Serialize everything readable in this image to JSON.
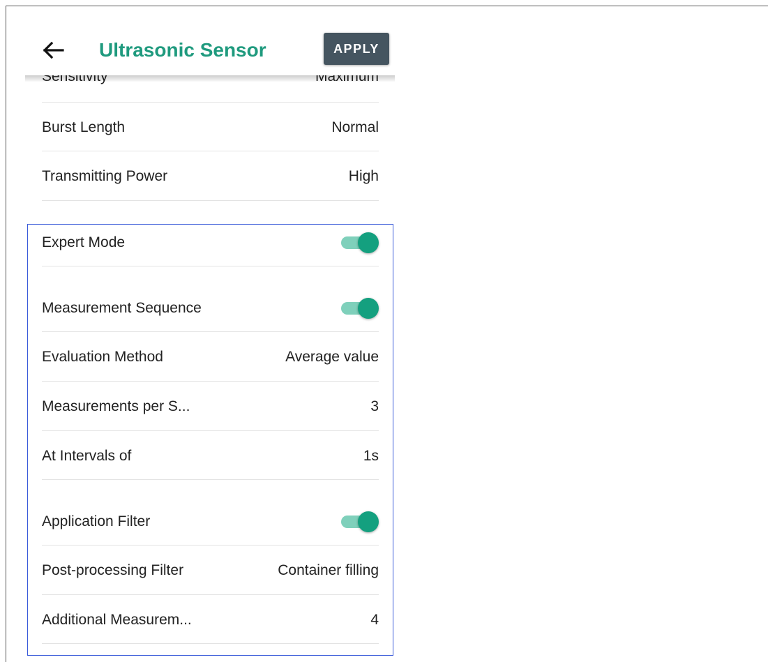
{
  "header": {
    "title": "Ultrasonic Sensor",
    "apply_label": "APPLY"
  },
  "settings": [
    {
      "label": "Sensitivity",
      "value": "Maximum"
    },
    {
      "label": "Burst Length",
      "value": "Normal"
    },
    {
      "label": "Transmitting Power",
      "value": "High"
    },
    {
      "label": "Expert Mode",
      "toggle": true
    },
    {
      "label": "Measurement Sequence",
      "toggle": true
    },
    {
      "label": "Evaluation Method",
      "value": "Average value"
    },
    {
      "label": "Measurements per S...",
      "value": "3"
    },
    {
      "label": "At Intervals of",
      "value": "1s"
    },
    {
      "label": "Application Filter",
      "toggle": true
    },
    {
      "label": "Post-processing Filter",
      "value": "Container filling"
    },
    {
      "label": "Additional Measurem...",
      "value": "4"
    }
  ],
  "colors": {
    "title": "#1f9a7e",
    "apply_button": "#455560",
    "toggle_thumb": "#14a07f",
    "toggle_track": "#7fd0bb",
    "highlight_border": "#3a5bd9"
  }
}
